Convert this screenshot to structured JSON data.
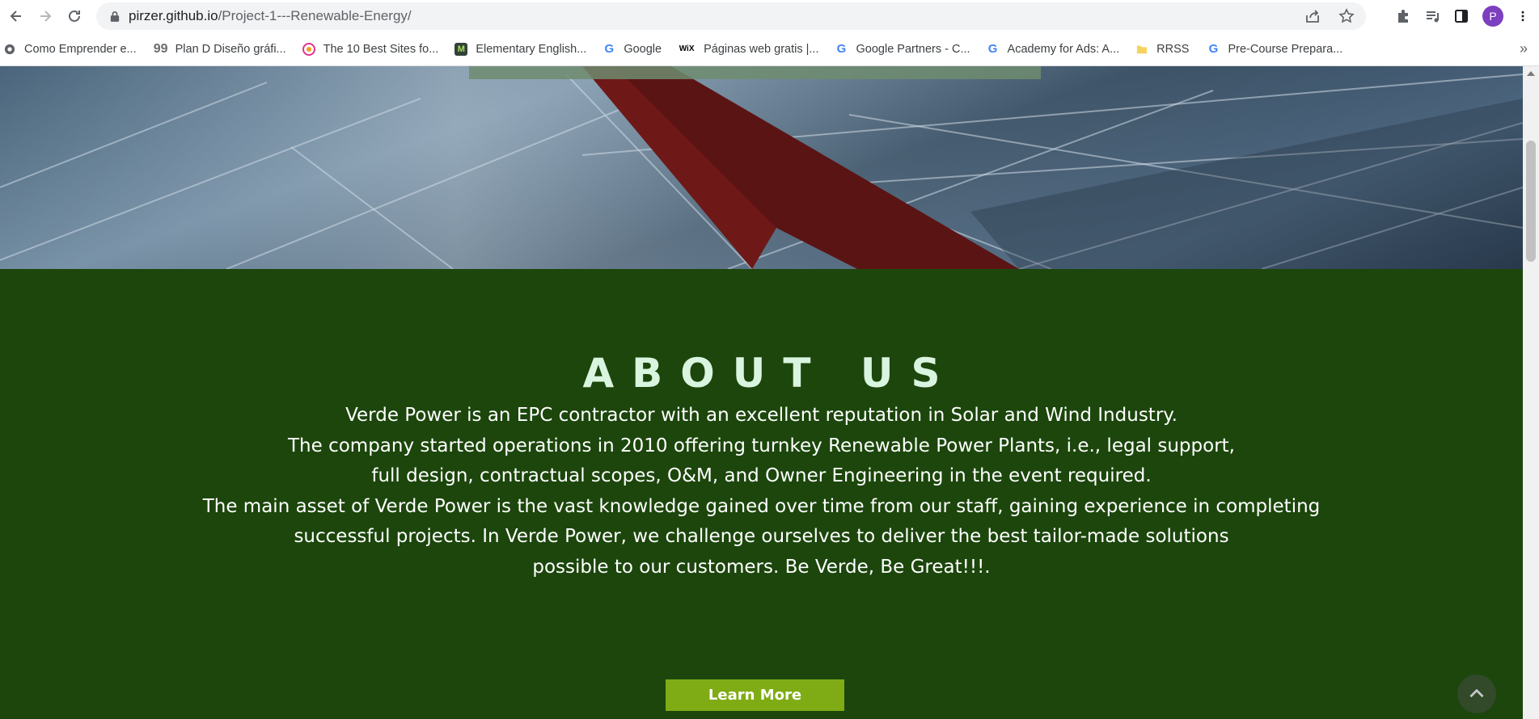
{
  "browser": {
    "url_host": "pirzer.github.io",
    "url_path": "/Project-1---Renewable-Energy/",
    "profile_initial": "P",
    "bookmarks": [
      {
        "label": "Como Emprender e...",
        "icon": "globe-icon"
      },
      {
        "label": "Plan D Diseño gráfi...",
        "icon": "quote-icon"
      },
      {
        "label": "The 10 Best Sites fo...",
        "icon": "site-icon"
      },
      {
        "label": "Elementary English...",
        "icon": "m-icon"
      },
      {
        "label": "Google",
        "icon": "google-icon"
      },
      {
        "label": "Páginas web gratis |...",
        "icon": "wix-icon"
      },
      {
        "label": "Google Partners - C...",
        "icon": "google-icon"
      },
      {
        "label": "Academy for Ads: A...",
        "icon": "google-icon"
      },
      {
        "label": "RRSS",
        "icon": "folder-icon"
      },
      {
        "label": "Pre-Course Prepara...",
        "icon": "google-icon"
      }
    ],
    "bookmarks_more": "»"
  },
  "about": {
    "title": "ABOUT US",
    "lines": [
      "Verde Power is an EPC contractor with an excellent reputation in Solar and Wind Industry.",
      "The company started operations in 2010 offering turnkey Renewable Power Plants, i.e., legal support,",
      "full design, contractual scopes, O&M, and Owner Engineering in the event required.",
      "The main asset of Verde Power is the vast knowledge gained over time from our staff, gaining experience in completing",
      "successful projects. In Verde Power, we challenge ourselves to deliver the best tailor-made solutions",
      "possible to our customers. Be Verde, Be Great!!!."
    ],
    "button_label": "Learn More"
  },
  "colors": {
    "about_bg": "#1c460c",
    "title_color": "#d9f5df",
    "button_bg": "#7fac14",
    "scroll_top_bg": "#32492a"
  }
}
